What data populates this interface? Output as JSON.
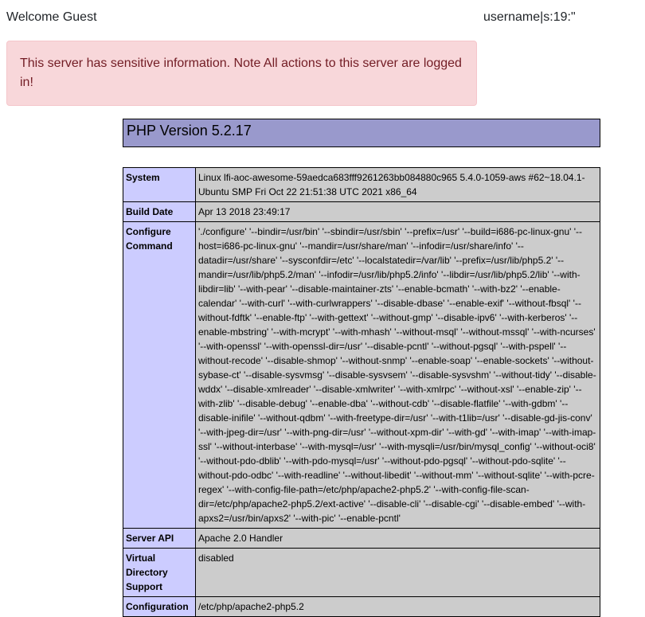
{
  "header": {
    "welcome": "Welcome Guest",
    "session": "username|s:19:\""
  },
  "alert": {
    "message": "This server has sensitive information. Note All actions to this server are logged in!"
  },
  "php": {
    "title": "PHP Version 5.2.17",
    "rows": [
      {
        "label": "System",
        "value": "Linux lfi-aoc-awesome-59aedca683fff9261263bb084880c965 5.4.0-1059-aws #62~18.04.1-Ubuntu SMP Fri Oct 22 21:51:38 UTC 2021 x86_64"
      },
      {
        "label": "Build Date",
        "value": "Apr 13 2018 23:49:17"
      },
      {
        "label": "Configure Command",
        "value": "'./configure' '--bindir=/usr/bin' '--sbindir=/usr/sbin' '--prefix=/usr' '--build=i686-pc-linux-gnu' '--host=i686-pc-linux-gnu' '--mandir=/usr/share/man' '--infodir=/usr/share/info' '--datadir=/usr/share' '--sysconfdir=/etc' '--localstatedir=/var/lib' '--prefix=/usr/lib/php5.2' '--mandir=/usr/lib/php5.2/man' '--infodir=/usr/lib/php5.2/info' '--libdir=/usr/lib/php5.2/lib' '--with-libdir=lib' '--with-pear' '--disable-maintainer-zts' '--enable-bcmath' '--with-bz2' '--enable-calendar' '--with-curl' '--with-curlwrappers' '--disable-dbase' '--enable-exif' '--without-fbsql' '--without-fdftk' '--enable-ftp' '--with-gettext' '--without-gmp' '--disable-ipv6' '--with-kerberos' '--enable-mbstring' '--with-mcrypt' '--with-mhash' '--without-msql' '--without-mssql' '--with-ncurses' '--with-openssl' '--with-openssl-dir=/usr' '--disable-pcntl' '--without-pgsql' '--with-pspell' '--without-recode' '--disable-shmop' '--without-snmp' '--enable-soap' '--enable-sockets' '--without-sybase-ct' '--disable-sysvmsg' '--disable-sysvsem' '--disable-sysvshm' '--without-tidy' '--disable-wddx' '--disable-xmlreader' '--disable-xmlwriter' '--with-xmlrpc' '--without-xsl' '--enable-zip' '--with-zlib' '--disable-debug' '--enable-dba' '--without-cdb' '--disable-flatfile' '--with-gdbm' '--disable-inifile' '--without-qdbm' '--with-freetype-dir=/usr' '--with-t1lib=/usr' '--disable-gd-jis-conv' '--with-jpeg-dir=/usr' '--with-png-dir=/usr' '--without-xpm-dir' '--with-gd' '--with-imap' '--with-imap-ssl' '--without-interbase' '--with-mysql=/usr' '--with-mysqli=/usr/bin/mysql_config' '--without-oci8' '--without-pdo-dblib' '--with-pdo-mysql=/usr' '--without-pdo-pgsql' '--without-pdo-sqlite' '--without-pdo-odbc' '--with-readline' '--without-libedit' '--without-mm' '--without-sqlite' '--with-pcre-regex' '--with-config-file-path=/etc/php/apache2-php5.2' '--with-config-file-scan-dir=/etc/php/apache2-php5.2/ext-active' '--disable-cli' '--disable-cgi' '--disable-embed' '--with-apxs2=/usr/bin/apxs2' '--with-pic' '--enable-pcntl'"
      },
      {
        "label": "Server API",
        "value": "Apache 2.0 Handler"
      },
      {
        "label": "Virtual Directory Support",
        "value": "disabled"
      },
      {
        "label": "Configuration",
        "value": "/etc/php/apache2-php5.2"
      }
    ]
  }
}
